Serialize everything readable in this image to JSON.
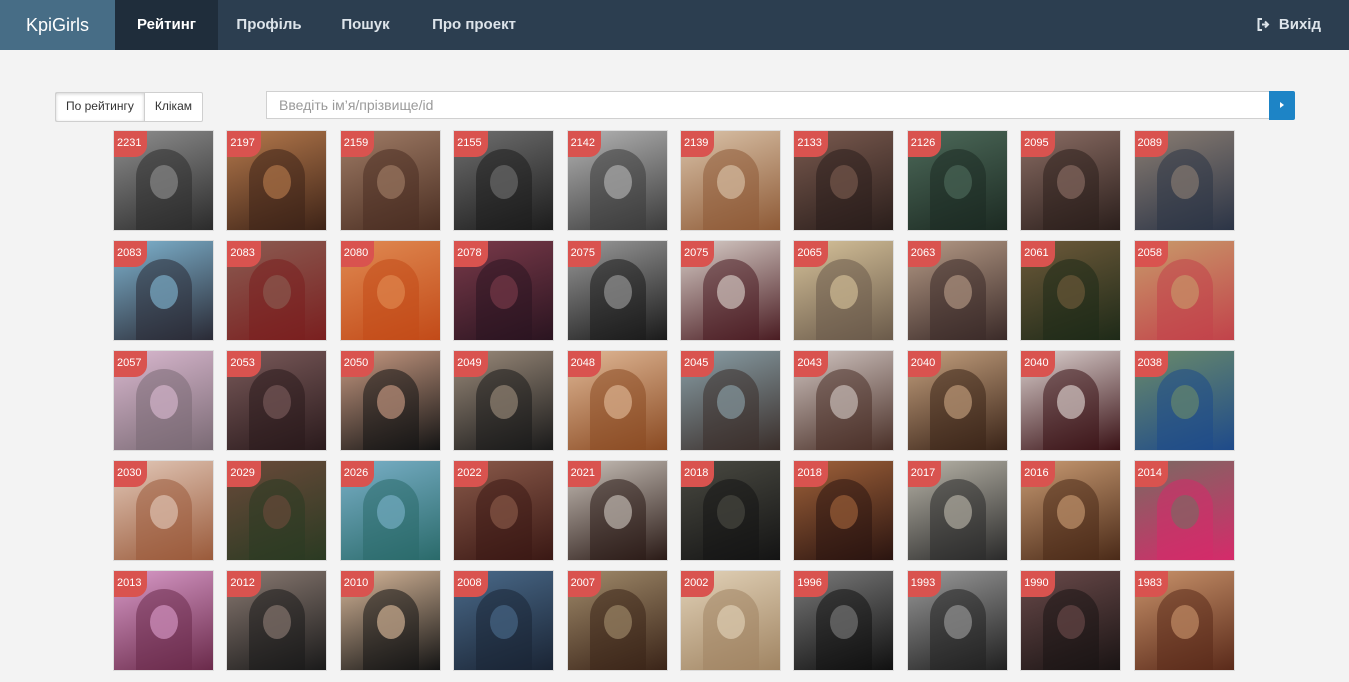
{
  "navbar": {
    "brand": "KpiGirls",
    "items": [
      {
        "label": "Рейтинг",
        "active": true
      },
      {
        "label": "Профіль",
        "active": false
      },
      {
        "label": "Пошук",
        "active": false
      },
      {
        "label": "Про проект",
        "active": false
      }
    ],
    "logout_label": "Вихід",
    "logout_icon": "sign-out-icon"
  },
  "sort": {
    "by_rating": "По рейтингу",
    "by_clicks": "Клікам",
    "active": "by_rating"
  },
  "search": {
    "placeholder": "Введіть ім’я/прізвище/id",
    "value": "",
    "button_icon": "caret-right-icon"
  },
  "colors": {
    "navbar": "#2c3e50",
    "brand_bg": "#476d86",
    "badge": "#d9534f",
    "search_button": "#1d84c6"
  },
  "photos": [
    {
      "score": "2231",
      "tone": "#8e8e8e",
      "dark": "#2b2b2b"
    },
    {
      "score": "2197",
      "tone": "#b5794c",
      "dark": "#3d2317"
    },
    {
      "score": "2159",
      "tone": "#a07c66",
      "dark": "#4a2e22"
    },
    {
      "score": "2155",
      "tone": "#6f6f6f",
      "dark": "#1c1c1c"
    },
    {
      "score": "2142",
      "tone": "#b4b4b4",
      "dark": "#3b3b3b"
    },
    {
      "score": "2139",
      "tone": "#dac3a9",
      "dark": "#8e5a36"
    },
    {
      "score": "2133",
      "tone": "#7a5a4f",
      "dark": "#2a1e1b"
    },
    {
      "score": "2126",
      "tone": "#4d6a5a",
      "dark": "#1c2a22"
    },
    {
      "score": "2095",
      "tone": "#8b6d64",
      "dark": "#2b1f1c"
    },
    {
      "score": "2089",
      "tone": "#8a7d72",
      "dark": "#2b3446"
    },
    {
      "score": "2083",
      "tone": "#7fb4d0",
      "dark": "#2a2a35"
    },
    {
      "score": "2083",
      "tone": "#8b5c52",
      "dark": "#7a1f1f"
    },
    {
      "score": "2080",
      "tone": "#e08a52",
      "dark": "#c24a18"
    },
    {
      "score": "2078",
      "tone": "#7a3a4a",
      "dark": "#2a1420"
    },
    {
      "score": "2075",
      "tone": "#9a9a9a",
      "dark": "#1a1a1a"
    },
    {
      "score": "2075",
      "tone": "#d8cec8",
      "dark": "#4a1c22"
    },
    {
      "score": "2065",
      "tone": "#d6c29a",
      "dark": "#6a5a4a"
    },
    {
      "score": "2063",
      "tone": "#b59a86",
      "dark": "#3a2a28"
    },
    {
      "score": "2061",
      "tone": "#6e5a3a",
      "dark": "#1e2a18"
    },
    {
      "score": "2058",
      "tone": "#c89a6a",
      "dark": "#c2424a"
    },
    {
      "score": "2057",
      "tone": "#d9b8cf",
      "dark": "#7a6a74"
    },
    {
      "score": "2053",
      "tone": "#7a5a5a",
      "dark": "#2a1a1c"
    },
    {
      "score": "2050",
      "tone": "#c89a82",
      "dark": "#141414"
    },
    {
      "score": "2049",
      "tone": "#9a8a7a",
      "dark": "#1a1a1a"
    },
    {
      "score": "2048",
      "tone": "#e0b896",
      "dark": "#8a4a22"
    },
    {
      "score": "2045",
      "tone": "#8aa0a8",
      "dark": "#3a2e2a"
    },
    {
      "score": "2043",
      "tone": "#d0c4c0",
      "dark": "#4a3028"
    },
    {
      "score": "2040",
      "tone": "#c4a07e",
      "dark": "#3a2418"
    },
    {
      "score": "2040",
      "tone": "#ddd2d0",
      "dark": "#3a1216"
    },
    {
      "score": "2038",
      "tone": "#6a8a6a",
      "dark": "#1e4a8a"
    },
    {
      "score": "2030",
      "tone": "#e2c8b8",
      "dark": "#9a5a3a"
    },
    {
      "score": "2029",
      "tone": "#6a4a3a",
      "dark": "#2a3a22"
    },
    {
      "score": "2026",
      "tone": "#7ab0c8",
      "dark": "#2a6a6a"
    },
    {
      "score": "2022",
      "tone": "#8a5a4a",
      "dark": "#3a1814"
    },
    {
      "score": "2021",
      "tone": "#c8c0b8",
      "dark": "#2a1a16"
    },
    {
      "score": "2018",
      "tone": "#4a4a42",
      "dark": "#141414"
    },
    {
      "score": "2018",
      "tone": "#a0623a",
      "dark": "#2a1410"
    },
    {
      "score": "2017",
      "tone": "#b8b4a8",
      "dark": "#2a2a2a"
    },
    {
      "score": "2016",
      "tone": "#c89a72",
      "dark": "#4a2a18"
    },
    {
      "score": "2014",
      "tone": "#7a6a62",
      "dark": "#d62a6a"
    },
    {
      "score": "2013",
      "tone": "#d89ac8",
      "dark": "#6a2a4a"
    },
    {
      "score": "2012",
      "tone": "#8a7a72",
      "dark": "#1a1a1a"
    },
    {
      "score": "2010",
      "tone": "#d8b89a",
      "dark": "#141414"
    },
    {
      "score": "2008",
      "tone": "#4a6a8a",
      "dark": "#1a2434"
    },
    {
      "score": "2007",
      "tone": "#a08a6a",
      "dark": "#3a2418"
    },
    {
      "score": "2002",
      "tone": "#e2d2b8",
      "dark": "#a08462"
    },
    {
      "score": "1996",
      "tone": "#7a7a7a",
      "dark": "#101010"
    },
    {
      "score": "1993",
      "tone": "#9a9a9a",
      "dark": "#202020"
    },
    {
      "score": "1990",
      "tone": "#6a4a4a",
      "dark": "#1a1414"
    },
    {
      "score": "1983",
      "tone": "#c8926a",
      "dark": "#5a2a1a"
    }
  ]
}
